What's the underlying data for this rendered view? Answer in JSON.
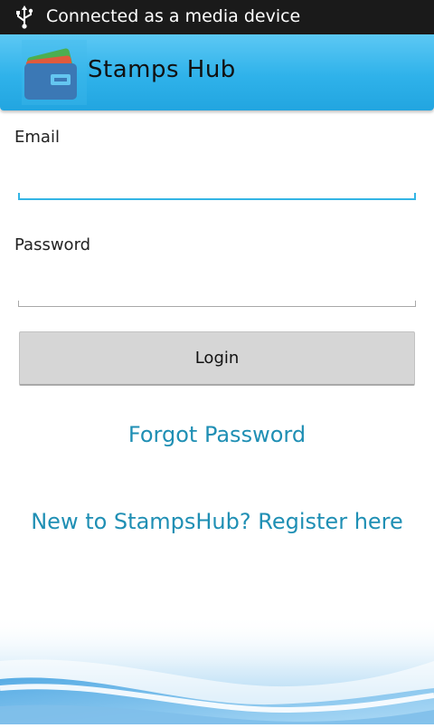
{
  "status_bar": {
    "text": "Connected as a media device",
    "icon": "usb-icon"
  },
  "app_bar": {
    "title": "Stamps Hub",
    "logo_icon": "wallet-cards-icon",
    "background_color": "#33b5e5"
  },
  "form": {
    "email_label": "Email",
    "email_value": "",
    "password_label": "Password",
    "password_value": "",
    "login_label": "Login"
  },
  "links": {
    "forgot_password": "Forgot Password",
    "register": "New to StampsHub? Register here",
    "link_color": "#1f8fb4"
  },
  "colors": {
    "accent": "#33b5e5",
    "button_bg": "#d6d6d6"
  }
}
